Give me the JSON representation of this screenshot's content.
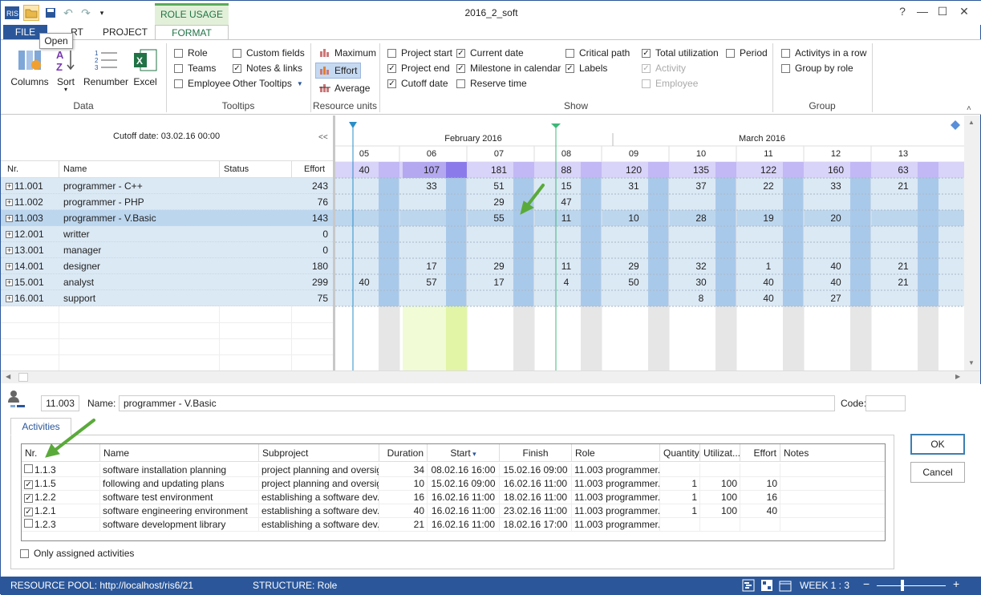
{
  "window": {
    "title": "2016_2_soft"
  },
  "tabs": {
    "file": "FILE",
    "insert": "RT",
    "project": "PROJECT",
    "format": "FORMAT",
    "context": "ROLE USAGE"
  },
  "tooltip": "Open",
  "ribbon": {
    "data": {
      "columns": "Columns",
      "sort": "Sort",
      "renumber": "Renumber",
      "excel": "Excel",
      "label": "Data"
    },
    "tooltips": {
      "role": "Role",
      "teams": "Teams",
      "employee": "Employee",
      "custom_fields": "Custom fields",
      "notes_links": "Notes & links",
      "other_tooltips": "Other Tooltips",
      "label": "Tooltips"
    },
    "resource_units": {
      "maximum": "Maximum",
      "effort": "Effort",
      "average": "Average",
      "label": "Resource units"
    },
    "show": {
      "project_start": "Project start",
      "project_end": "Project end",
      "cutoff_date": "Cutoff date",
      "current_date": "Current date",
      "milestone_calendar": "Milestone in calendar",
      "reserve_time": "Reserve time",
      "critical_path": "Critical path",
      "labels": "Labels",
      "total_utilization": "Total utilization",
      "activity": "Activity",
      "employee": "Employee",
      "period": "Period",
      "label": "Show"
    },
    "group": {
      "activities_row": "Activitys in a row",
      "group_by_role": "Group by role",
      "label": "Group"
    }
  },
  "grid": {
    "cutoff": "Cutoff date: 03.02.16 00:00",
    "collapse": "<<",
    "headers": {
      "nr": "Nr.",
      "name": "Name",
      "status": "Status",
      "effort": "Effort"
    },
    "rows": [
      {
        "nr": "11.001",
        "name": "programmer - C++",
        "effort": "243"
      },
      {
        "nr": "11.002",
        "name": "programmer - PHP",
        "effort": "76"
      },
      {
        "nr": "11.003",
        "name": "programmer - V.Basic",
        "effort": "143"
      },
      {
        "nr": "12.001",
        "name": "writter",
        "effort": "0"
      },
      {
        "nr": "13.001",
        "name": "manager",
        "effort": "0"
      },
      {
        "nr": "14.001",
        "name": "designer",
        "effort": "180"
      },
      {
        "nr": "15.001",
        "name": "analyst",
        "effort": "299"
      },
      {
        "nr": "16.001",
        "name": "support",
        "effort": "75"
      }
    ]
  },
  "timeline": {
    "months": [
      "February 2016",
      "March 2016"
    ],
    "weeks": [
      "05",
      "06",
      "07",
      "08",
      "09",
      "10",
      "11",
      "12",
      "13"
    ],
    "totals": [
      "40",
      "107",
      "181",
      "88",
      "120",
      "135",
      "122",
      "160",
      "63"
    ],
    "values": [
      [
        "",
        "33",
        "51",
        "15",
        "31",
        "37",
        "22",
        "33",
        "21"
      ],
      [
        "",
        "",
        "29",
        "47",
        "",
        "",
        "",
        "",
        ""
      ],
      [
        "",
        "",
        "55",
        "11",
        "10",
        "28",
        "19",
        "20",
        ""
      ],
      [
        "",
        "",
        "",
        "",
        "",
        "",
        "",
        "",
        ""
      ],
      [
        "",
        "",
        "",
        "",
        "",
        "",
        "",
        "",
        ""
      ],
      [
        "",
        "17",
        "29",
        "11",
        "29",
        "32",
        "1",
        "40",
        "21"
      ],
      [
        "40",
        "57",
        "17",
        "4",
        "50",
        "30",
        "40",
        "40",
        "21"
      ],
      [
        "",
        "",
        "",
        "",
        "",
        "8",
        "40",
        "27",
        ""
      ]
    ]
  },
  "detail": {
    "nr": "11.003",
    "name_label": "Name:",
    "name": "programmer - V.Basic",
    "code_label": "Code:",
    "tab": "Activities",
    "ok": "OK",
    "cancel": "Cancel",
    "only_assigned": "Only assigned activities",
    "headers": {
      "nr": "Nr.",
      "name": "Name",
      "subproject": "Subproject",
      "duration": "Duration",
      "start": "Start",
      "finish": "Finish",
      "role": "Role",
      "quantity": "Quantity",
      "utilization": "Utilizat...",
      "effort": "Effort",
      "notes": "Notes"
    },
    "activities": [
      {
        "checked": false,
        "nr": "1.1.3",
        "name": "software installation planning",
        "subproject": "project planning and oversight",
        "duration": "34",
        "start": "08.02.16 16:00",
        "finish": "15.02.16 09:00",
        "role": "11.003 programmer...",
        "quantity": "",
        "utilization": "",
        "effort": ""
      },
      {
        "checked": true,
        "nr": "1.1.5",
        "name": "following and updating plans",
        "subproject": "project planning and oversight",
        "duration": "10",
        "start": "15.02.16 09:00",
        "finish": "16.02.16 11:00",
        "role": "11.003 programmer...",
        "quantity": "1",
        "utilization": "100",
        "effort": "10"
      },
      {
        "checked": true,
        "nr": "1.2.2",
        "name": "software test environment",
        "subproject": "establishing a software dev...",
        "duration": "16",
        "start": "16.02.16 11:00",
        "finish": "18.02.16 11:00",
        "role": "11.003 programmer...",
        "quantity": "1",
        "utilization": "100",
        "effort": "16"
      },
      {
        "checked": true,
        "nr": "1.2.1",
        "name": "software engineering environment",
        "subproject": "establishing a software dev...",
        "duration": "40",
        "start": "16.02.16 11:00",
        "finish": "23.02.16 11:00",
        "role": "11.003 programmer...",
        "quantity": "1",
        "utilization": "100",
        "effort": "40"
      },
      {
        "checked": false,
        "nr": "1.2.3",
        "name": "software development library",
        "subproject": "establishing a software dev...",
        "duration": "21",
        "start": "16.02.16 11:00",
        "finish": "18.02.16 17:00",
        "role": "11.003 programmer...",
        "quantity": "",
        "utilization": "",
        "effort": ""
      }
    ]
  },
  "status": {
    "pool": "RESOURCE POOL: http://localhost/ris6/21",
    "structure": "STRUCTURE: Role",
    "week": "WEEK 1 : 3"
  },
  "colors": {
    "accent": "#2b579a",
    "context_green": "#217346",
    "row_bg": "#dbe9f5",
    "row_selected": "#bcd6ee",
    "total_bg": "#c9c3f5",
    "arrow": "#5aaa3a"
  }
}
